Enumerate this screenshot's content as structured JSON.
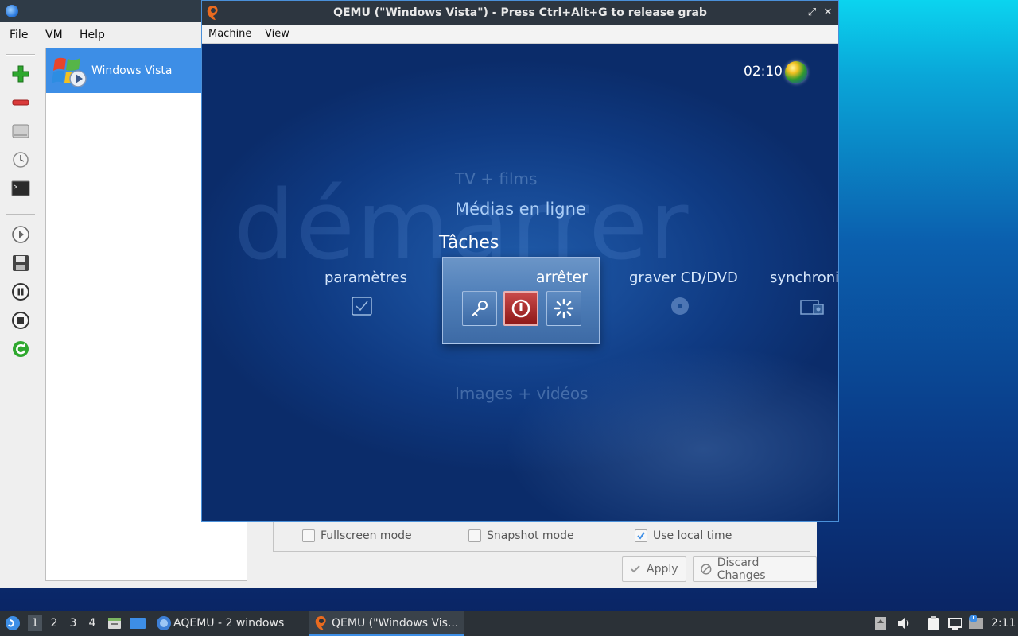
{
  "aqemu": {
    "menu": [
      "File",
      "VM",
      "Help"
    ],
    "toolbar_icons": [
      "add-vm-icon",
      "remove-vm-icon",
      "disk-icon",
      "clock-icon",
      "terminal-icon",
      "start-icon",
      "save-icon",
      "pause-icon",
      "stop-icon",
      "reset-icon"
    ],
    "vm_list": [
      {
        "name": "Windows Vista"
      }
    ],
    "options": {
      "fullscreen_label": "Fullscreen mode",
      "fullscreen_checked": false,
      "snapshot_label": "Snapshot mode",
      "snapshot_checked": false,
      "localtime_label": "Use local time",
      "localtime_checked": true
    },
    "buttons": {
      "apply": "Apply",
      "discard": "Discard Changes"
    }
  },
  "qemu": {
    "title": "QEMU (\"Windows Vista\") - Press Ctrl+Alt+G to release grab",
    "menu": [
      "Machine",
      "View"
    ],
    "window_controls": [
      "_",
      "⤢",
      "✕"
    ]
  },
  "guest": {
    "clock": "02:10",
    "background_word": "démarrer",
    "menu_above_2": "TV + films",
    "menu_above_1": "Médias en ligne",
    "current_category": "Tâches",
    "menu_below": "Images + vidéos",
    "strip_left": "paramètres",
    "strip_selected": "arrêter",
    "strip_right_1": "graver CD/DVD",
    "strip_right_2": "synchronis"
  },
  "taskbar": {
    "workspaces": [
      "1",
      "2",
      "3",
      "4"
    ],
    "active_workspace": "1",
    "tasks": [
      {
        "label": "AQEMU - 2 windows"
      },
      {
        "label": "QEMU (\"Windows Vis..."
      }
    ],
    "clock": "2:11"
  },
  "colors": {
    "selection": "#3d8ee6",
    "titlebar": "#2f3b47",
    "power_button": "#b52a2a"
  }
}
